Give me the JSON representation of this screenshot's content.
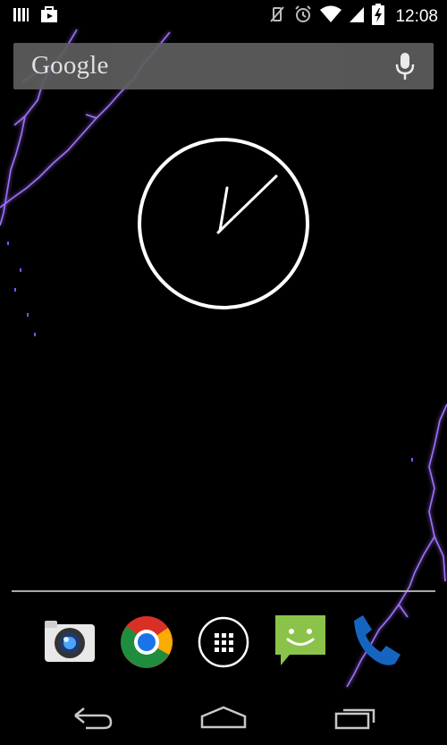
{
  "status_bar": {
    "time": "12:08",
    "left_icons": [
      "signal-bars-icon",
      "play-store-bag-icon"
    ],
    "right_icons": [
      "vibrate-off-icon",
      "alarm-icon",
      "wifi-icon",
      "cell-signal-icon",
      "battery-charging-icon"
    ]
  },
  "search": {
    "logo_text": "Google",
    "voice_icon": "mic-icon"
  },
  "clock": {
    "type": "analog",
    "color": "#ffffff"
  },
  "dock": {
    "apps": [
      "camera",
      "chrome",
      "app-drawer",
      "messaging",
      "phone"
    ]
  },
  "nav": {
    "buttons": [
      "back",
      "home",
      "recents"
    ]
  },
  "colors": {
    "background": "#000000",
    "lightning": "#8a4bff",
    "search_bar": "#5e5e5e",
    "messaging": "#8bc34a",
    "phone": "#1565c0"
  }
}
